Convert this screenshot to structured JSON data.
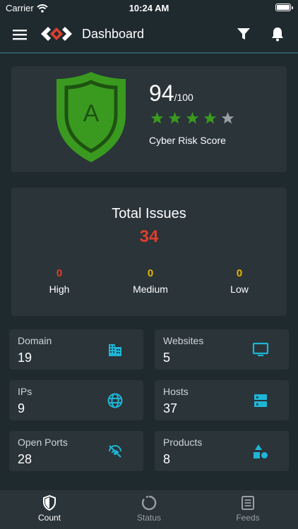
{
  "status_bar": {
    "carrier": "Carrier",
    "time": "10:24 AM"
  },
  "navbar": {
    "title": "Dashboard"
  },
  "score": {
    "value": "94",
    "denominator": "/100",
    "grade": "A",
    "label": "Cyber Risk Score",
    "stars_filled": 4,
    "stars_total": 5
  },
  "issues": {
    "title": "Total Issues",
    "total": "34",
    "high": {
      "count": "0",
      "label": "High",
      "color": "#e03e2d"
    },
    "medium": {
      "count": "0",
      "label": "Medium",
      "color": "#e6b800"
    },
    "low": {
      "count": "0",
      "label": "Low",
      "color": "#e6b800"
    }
  },
  "tiles": {
    "domain": {
      "label": "Domain",
      "value": "19",
      "icon": "building-icon"
    },
    "websites": {
      "label": "Websites",
      "value": "5",
      "icon": "monitor-icon"
    },
    "ips": {
      "label": "IPs",
      "value": "9",
      "icon": "globe-icon"
    },
    "hosts": {
      "label": "Hosts",
      "value": "37",
      "icon": "server-icon"
    },
    "open_ports": {
      "label": "Open Ports",
      "value": "28",
      "icon": "port-off-icon"
    },
    "products": {
      "label": "Products",
      "value": "8",
      "icon": "shapes-icon"
    }
  },
  "tabs": {
    "count": "Count",
    "status": "Status",
    "feeds": "Feeds"
  },
  "colors": {
    "accent": "#1fb5d6",
    "shield_green": "#3a9a1f",
    "star_green": "#3a9a1f",
    "star_grey": "#9aa0a3",
    "danger": "#e03e2d",
    "warning": "#e6b800"
  }
}
